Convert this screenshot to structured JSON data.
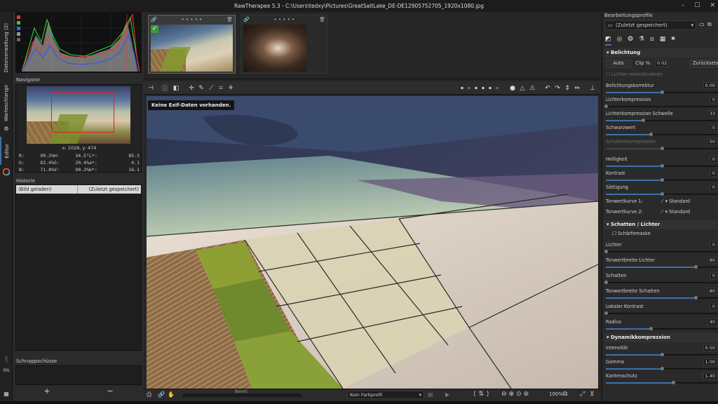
{
  "window": {
    "title": "RawTherapee 5.3 - C:\\Users\\tedxy\\Pictures\\GreatSaltLake_DE-DE12905752705_1920x1080.jpg",
    "controls": [
      "–",
      "☐",
      "✕"
    ]
  },
  "vtabs": {
    "filebrowser": "Dateiverwaltung (2)",
    "queue": "Warteschlange",
    "editor": "Editor",
    "percent": "0%"
  },
  "navigator": {
    "title": "Navigator",
    "coords": "x: 1028, y: 474",
    "readout": [
      [
        "R:",
        "90.2%",
        "H:",
        "34.5°",
        "L*:",
        "85.3"
      ],
      [
        "G:",
        "82.4%",
        "S:",
        "20.4%",
        "a*:",
        "4.1"
      ],
      [
        "B:",
        "71.8%",
        "V:",
        "90.2%",
        "b*:",
        "16.1"
      ]
    ]
  },
  "history": {
    "title": "Historie",
    "col1": "(Bild geladen)",
    "col2": "(Zuletzt gespeichert)"
  },
  "snapshots": {
    "title": "Schnappschüsse",
    "add": "+",
    "remove": "−"
  },
  "filmstrip": {
    "stars": "• • • • •",
    "trash": "🗑"
  },
  "preview": {
    "exif_message": "Keine Exif-Daten vorhanden."
  },
  "bottombar": {
    "status": "Bereit",
    "profile": "Kein Farbprofil",
    "zoom": "100%"
  },
  "right": {
    "profiles_label": "Bearbeitungsprofile",
    "profile_value": "(Zuletzt gespeichert)",
    "exposure": {
      "title": "Belichtung",
      "auto": "Auto",
      "clip_label": "Clip %:",
      "clip_value": "0.02",
      "reset": "Zurücksetzen",
      "reconstruct": "Lichter rekonstruieren",
      "rows": [
        {
          "label": "Belichtungskorrektur",
          "value": "0.00",
          "fill": 0.5,
          "dim": false
        },
        {
          "label": "Lichterkompression",
          "value": "0",
          "fill": 0.0,
          "dim": false
        },
        {
          "label": "Lichterkompression Schwelle",
          "value": "33",
          "fill": 0.33,
          "dim": false
        },
        {
          "label": "Schwarzwert",
          "value": "0",
          "fill": 0.4,
          "dim": false
        },
        {
          "label": "Schattenkompression",
          "value": "50",
          "fill": 0.5,
          "dim": true
        },
        {
          "label": "Helligkeit",
          "value": "0",
          "fill": 0.5,
          "dim": false
        },
        {
          "label": "Kontrast",
          "value": "0",
          "fill": 0.5,
          "dim": false
        },
        {
          "label": "Sättigung",
          "value": "0",
          "fill": 0.5,
          "dim": false
        }
      ],
      "curve1": "Tonwertkurve 1:",
      "curve2": "Tonwertkurve 2:",
      "curve_value": "Standard"
    },
    "shadows": {
      "title": "Schatten / Lichter",
      "mask": "Schärfemaske",
      "rows": [
        {
          "label": "Lichter",
          "value": "0",
          "fill": 0.0
        },
        {
          "label": "Tonwertbreite Lichter",
          "value": "80",
          "fill": 0.8
        },
        {
          "label": "Schatten",
          "value": "0",
          "fill": 0.0
        },
        {
          "label": "Tonwertbreite Schatten",
          "value": "80",
          "fill": 0.8
        },
        {
          "label": "Lokaler Kontrast",
          "value": "0",
          "fill": 0.0
        },
        {
          "label": "Radius",
          "value": "40",
          "fill": 0.4
        }
      ]
    },
    "dynamic": {
      "title": "Dynamikkompression",
      "rows": [
        {
          "label": "Intensität",
          "value": "0.50",
          "fill": 0.5
        },
        {
          "label": "Gamma",
          "value": "1.00",
          "fill": 0.5
        },
        {
          "label": "Kantenschutz",
          "value": "1.40",
          "fill": 0.6
        }
      ]
    }
  },
  "colors": {
    "accent": "#3f6fa8",
    "histogram_red": "#ff3030",
    "histogram_green": "#30e030",
    "histogram_blue": "#3050ff"
  }
}
